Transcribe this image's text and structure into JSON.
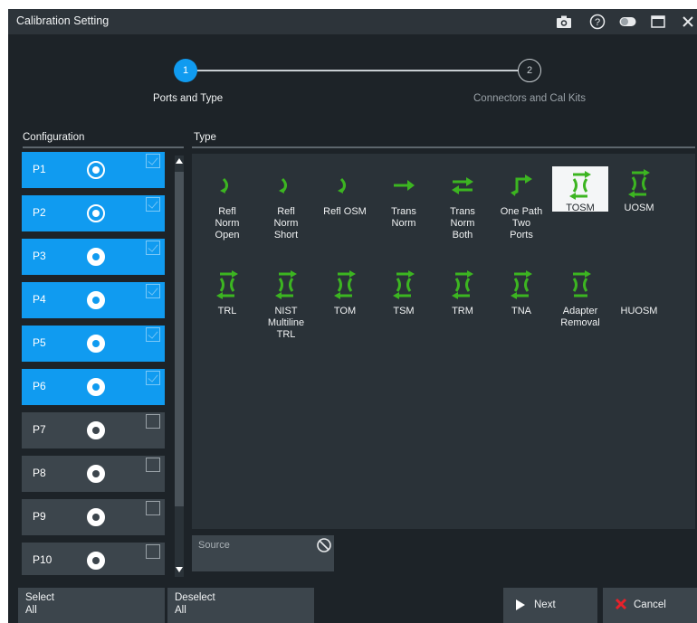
{
  "window": {
    "title": "Calibration Setting"
  },
  "wizard": {
    "steps": [
      {
        "number": "1",
        "label": "Ports and Type",
        "active": true
      },
      {
        "number": "2",
        "label": "Connectors and Cal Kits",
        "active": false
      }
    ]
  },
  "configuration": {
    "header": "Configuration",
    "ports": [
      {
        "label": "P1",
        "selected": true,
        "checked": true
      },
      {
        "label": "P2",
        "selected": true,
        "checked": true
      },
      {
        "label": "P3",
        "selected": true,
        "checked": true
      },
      {
        "label": "P4",
        "selected": true,
        "checked": true
      },
      {
        "label": "P5",
        "selected": true,
        "checked": true
      },
      {
        "label": "P6",
        "selected": true,
        "checked": true
      },
      {
        "label": "P7",
        "selected": false,
        "checked": false
      },
      {
        "label": "P8",
        "selected": false,
        "checked": false
      },
      {
        "label": "P9",
        "selected": false,
        "checked": false
      },
      {
        "label": "P10",
        "selected": false,
        "checked": false
      }
    ]
  },
  "type": {
    "header": "Type",
    "selected": "TOSM",
    "items": [
      {
        "label": "Refl\nNorm\nOpen",
        "icon": "refl-icon"
      },
      {
        "label": "Refl\nNorm\nShort",
        "icon": "refl-icon"
      },
      {
        "label": "Refl OSM",
        "icon": "refl-icon"
      },
      {
        "label": "Trans\nNorm",
        "icon": "trans-arrow-icon"
      },
      {
        "label": "Trans\nNorm\nBoth",
        "icon": "trans-both-icon"
      },
      {
        "label": "One Path\nTwo\nPorts",
        "icon": "one-path-icon"
      },
      {
        "label": "TOSM",
        "icon": "two-port-cal-icon"
      },
      {
        "label": "UOSM",
        "icon": "two-port-cal-icon"
      },
      {
        "label": "TRL",
        "icon": "two-port-cal-icon"
      },
      {
        "label": "NIST\nMultiline\nTRL",
        "icon": "two-port-cal-icon"
      },
      {
        "label": "TOM",
        "icon": "two-port-cal-icon"
      },
      {
        "label": "TSM",
        "icon": "two-port-cal-icon"
      },
      {
        "label": "TRM",
        "icon": "two-port-cal-icon"
      },
      {
        "label": "TNA",
        "icon": "two-port-cal-icon"
      },
      {
        "label": "Adapter\nRemoval",
        "icon": "adapter-icon"
      },
      {
        "label": "HUOSM",
        "icon": "none"
      }
    ]
  },
  "source": {
    "placeholder": "Source"
  },
  "buttons": {
    "select_all": "Select\nAll",
    "deselect_all": "Deselect\nAll",
    "next": "Next",
    "cancel": "Cancel"
  },
  "colors": {
    "accent": "#109bf0",
    "icon_green": "#3cb521",
    "cancel_red": "#e8212a",
    "background": "#1d2328",
    "panel": "#2a3238"
  }
}
